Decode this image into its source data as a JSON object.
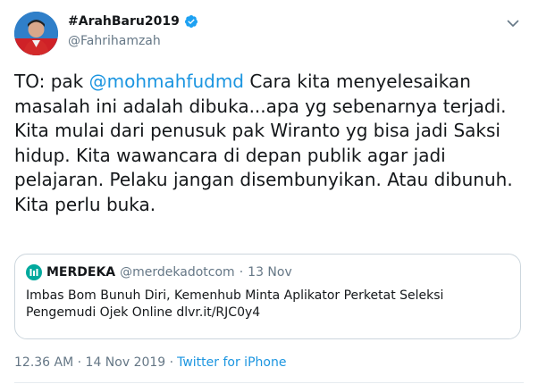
{
  "author": {
    "display_name": "#ArahBaru2019",
    "handle": "@Fahrihamzah",
    "verified": true,
    "avatar_icon": "avatar-photo"
  },
  "tweet": {
    "prefix": "TO: pak ",
    "mention": "@mohmahfudmd",
    "body": " Cara kita menyelesaikan masalah ini adalah dibuka...apa yg sebenarnya terjadi. Kita mulai dari penusuk pak Wiranto yg bisa jadi Saksi hidup. Kita wawancara di depan publik agar jadi pelajaran. Pelaku jangan disembunyikan. Atau dibunuh. Kita perlu buka."
  },
  "quote": {
    "name": "MERDEKA",
    "handle": "@merdekadotcom",
    "separator": "·",
    "date": "13 Nov",
    "text": "Imbas Bom Bunuh Diri, Kemenhub Minta Aplikator Perketat Seleksi Pengemudi Ojek Online dlvr.it/RJC0y4",
    "logo_icon": "merdeka-logo"
  },
  "meta": {
    "timestamp": "12.36 AM · 14 Nov 2019 · ",
    "source": "Twitter for iPhone"
  },
  "colors": {
    "link": "#1b95e0",
    "secondary_text": "#657786",
    "verified": "#1da1f2",
    "border": "#ccd6dd"
  }
}
